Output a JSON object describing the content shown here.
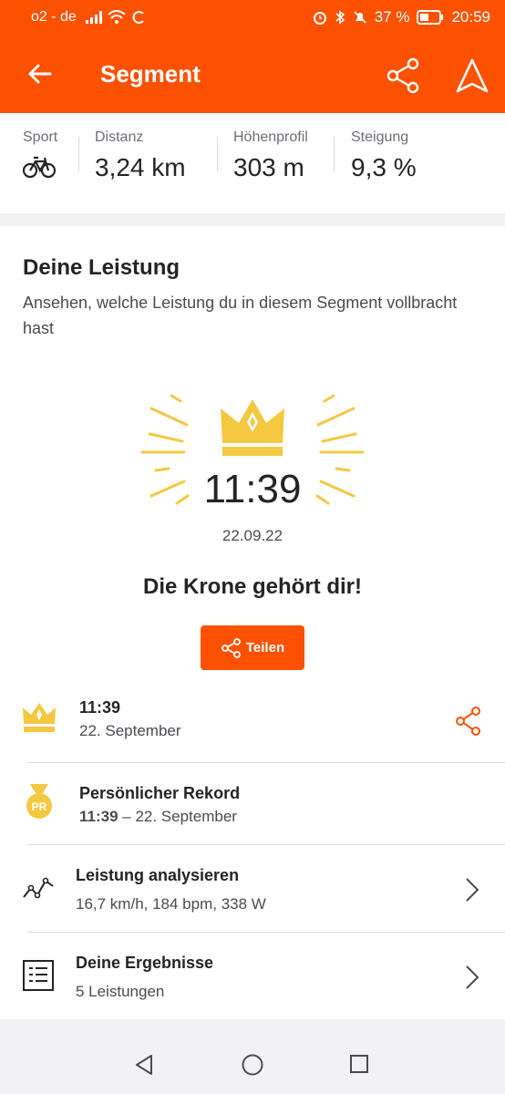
{
  "status": {
    "carrier": "o2 - de",
    "battery": "37 %",
    "time": "20:59"
  },
  "appbar": {
    "title": "Segment"
  },
  "stats": [
    {
      "label": "Sport",
      "value": ""
    },
    {
      "label": "Distanz",
      "value": "3,24 km"
    },
    {
      "label": "Höhenprofil",
      "value": "303 m"
    },
    {
      "label": "Steigung",
      "value": "9,3 %"
    }
  ],
  "performance": {
    "title": "Deine Leistung",
    "subtitle": "Ansehen, welche Leistung du in diesem Segment vollbracht hast",
    "time": "11:39",
    "date": "22.09.22",
    "message": "Die Krone gehört dir!",
    "share_label": "Teilen"
  },
  "rows": [
    {
      "title": "11:39",
      "subtitle": "22. September"
    },
    {
      "title": "Persönlicher Rekord",
      "subtitle_bold": "11:39",
      "subtitle_rest": " – 22. September",
      "badge": "PR"
    },
    {
      "title": "Leistung analysieren",
      "subtitle": "16,7 km/h, 184 bpm, 338 W"
    },
    {
      "title": "Deine Ergebnisse",
      "subtitle": "5 Leistungen"
    }
  ],
  "colors": {
    "brand": "#fc5200",
    "gold": "#f5c842"
  }
}
